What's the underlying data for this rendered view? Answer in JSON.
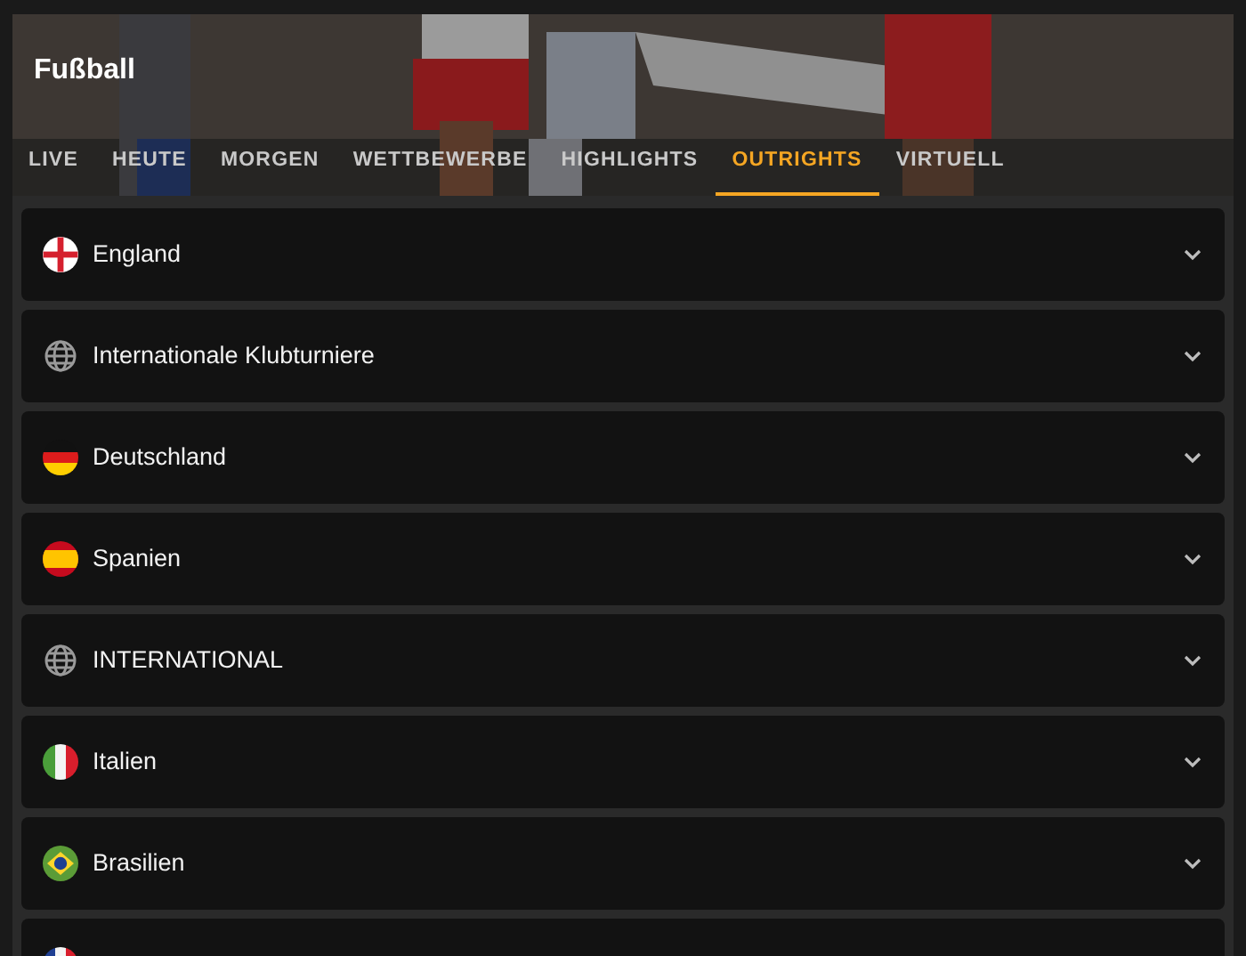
{
  "header": {
    "title": "Fußball"
  },
  "tabs": [
    {
      "label": "LIVE",
      "selected": false
    },
    {
      "label": "HEUTE",
      "selected": false
    },
    {
      "label": "MORGEN",
      "selected": false
    },
    {
      "label": "WETTBEWERBE",
      "selected": false
    },
    {
      "label": "HIGHLIGHTS",
      "selected": false
    },
    {
      "label": "OUTRIGHTS",
      "selected": true
    },
    {
      "label": "VIRTUELL",
      "selected": false
    }
  ],
  "regions": [
    {
      "name": "England",
      "kind": "england",
      "expanded": false
    },
    {
      "name": "Internationale Klubturniere",
      "kind": "globe",
      "expanded": false
    },
    {
      "name": "Deutschland",
      "kind": "germany",
      "expanded": false
    },
    {
      "name": "Spanien",
      "kind": "spain",
      "expanded": false
    },
    {
      "name": "INTERNATIONAL",
      "kind": "globe",
      "expanded": false
    },
    {
      "name": "Italien",
      "kind": "italy",
      "expanded": false
    },
    {
      "name": "Brasilien",
      "kind": "brazil",
      "expanded": false
    },
    {
      "kind": "france"
    }
  ]
}
